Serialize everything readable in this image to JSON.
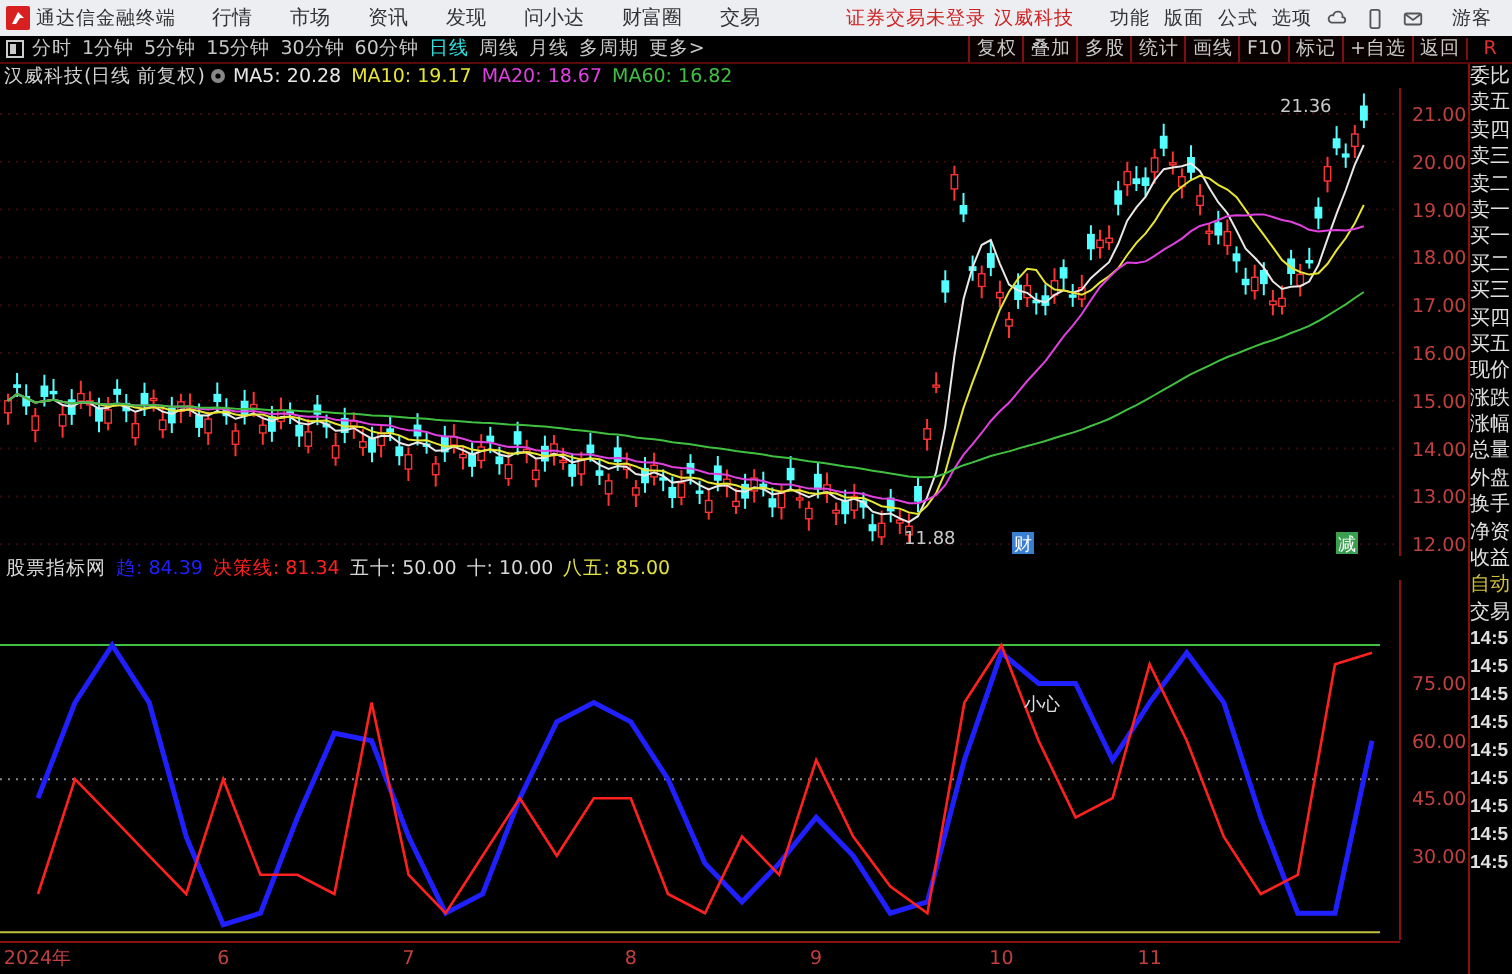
{
  "menubar": {
    "app_name": "通达信金融终端",
    "menus": [
      "行情",
      "市场",
      "资讯",
      "发现",
      "问小达",
      "财富圈",
      "交易"
    ],
    "login_notice": "证券交易未登录",
    "stock_name": "汉威科技",
    "right_menus": [
      "功能",
      "版面",
      "公式",
      "选项"
    ],
    "user": "游客"
  },
  "toolbar": {
    "periods": [
      {
        "label": "分时",
        "selected": false
      },
      {
        "label": "1分钟",
        "selected": false
      },
      {
        "label": "5分钟",
        "selected": false
      },
      {
        "label": "15分钟",
        "selected": false
      },
      {
        "label": "30分钟",
        "selected": false
      },
      {
        "label": "60分钟",
        "selected": false
      },
      {
        "label": "日线",
        "selected": true
      },
      {
        "label": "周线",
        "selected": false
      },
      {
        "label": "月线",
        "selected": false
      },
      {
        "label": "多周期",
        "selected": false
      },
      {
        "label": "更多>",
        "selected": false
      }
    ],
    "buttons": [
      "复权",
      "叠加",
      "多股",
      "统计",
      "画线",
      "F10",
      "标记",
      "+自选",
      "返回"
    ],
    "corner": "R"
  },
  "price_panel": {
    "title": "汉威科技(日线 前复权)",
    "ma_legend": [
      {
        "label": "MA5: 20.28",
        "color": "#e8e8e8"
      },
      {
        "label": "MA10: 19.17",
        "color": "#e6e633"
      },
      {
        "label": "MA20: 18.67",
        "color": "#e040e0"
      },
      {
        "label": "MA60: 16.82",
        "color": "#40c040"
      }
    ],
    "axis_labels": [
      "21.00",
      "20.00",
      "19.00",
      "18.00",
      "17.00",
      "16.00",
      "15.00",
      "14.00",
      "13.00",
      "12.00"
    ],
    "high_label": "21.36",
    "low_label": "11.88",
    "markers": [
      {
        "text": "财",
        "color": "#3a7fd0"
      },
      {
        "text": "减",
        "color": "#3aa050"
      }
    ]
  },
  "indicator_panel": {
    "title": "股票指标网",
    "legend": [
      {
        "kind": "series",
        "value": ": 84.39"
      },
      {
        "kind": "series",
        "value": ": 81.34"
      },
      {
        "kind": "level",
        "label": "五十",
        "value": ": 50.00",
        "color": "#d8d8d8"
      },
      {
        "kind": "level",
        "label": "十",
        "value": ": 10.00",
        "color": "#d8d8d8"
      },
      {
        "kind": "level",
        "label": "八五",
        "value": ": 85.00",
        "color": "#e0e040"
      }
    ],
    "note": "小心",
    "chart_data": {
      "type": "line",
      "categories": [
        "2024年",
        null,
        null,
        null,
        null,
        "6",
        null,
        null,
        null,
        null,
        "7",
        null,
        null,
        null,
        null,
        null,
        "8",
        null,
        null,
        null,
        null,
        "9",
        null,
        null,
        null,
        null,
        "10",
        null,
        null,
        null,
        "11",
        null,
        null,
        null,
        null,
        null,
        null
      ],
      "ylim": [
        8,
        102
      ],
      "yticks": [
        {
          "value": 30,
          "label": "30.00"
        },
        {
          "value": 45,
          "label": "45.00"
        },
        {
          "value": 60,
          "label": "60.00"
        },
        {
          "value": 75,
          "label": "75.00"
        }
      ],
      "series": [
        {
          "name": "趋",
          "color": "#2020ff",
          "values": [
            45,
            70,
            85,
            70,
            35,
            12,
            15,
            40,
            62,
            60,
            35,
            15,
            20,
            45,
            65,
            70,
            65,
            50,
            28,
            18,
            28,
            40,
            30,
            15,
            18,
            55,
            83,
            75,
            75,
            55,
            70,
            83,
            70,
            40,
            15,
            15,
            60
          ]
        },
        {
          "name": "决策线",
          "color": "#ff2020",
          "values": [
            20,
            50,
            40,
            30,
            20,
            50,
            25,
            25,
            20,
            70,
            25,
            15,
            30,
            45,
            30,
            45,
            45,
            20,
            15,
            35,
            25,
            55,
            35,
            22,
            15,
            70,
            85,
            60,
            40,
            45,
            80,
            60,
            35,
            20,
            25,
            80,
            83
          ]
        }
      ]
    }
  },
  "side_panel": [
    {
      "label": "委比",
      "kind": "quote"
    },
    {
      "label": "卖五",
      "kind": "quote"
    },
    {
      "label": "卖四",
      "kind": "quote"
    },
    {
      "label": "卖三",
      "kind": "quote"
    },
    {
      "label": "卖二",
      "kind": "quote"
    },
    {
      "label": "卖一",
      "kind": "quote"
    },
    {
      "label": "买一",
      "kind": "quote"
    },
    {
      "label": "买二",
      "kind": "quote"
    },
    {
      "label": "买三",
      "kind": "quote"
    },
    {
      "label": "买四",
      "kind": "quote"
    },
    {
      "label": "买五",
      "kind": "quote"
    },
    {
      "label": "现价",
      "kind": "quote"
    },
    {
      "label": "涨跌",
      "kind": "quote"
    },
    {
      "label": "涨幅",
      "kind": "quote"
    },
    {
      "label": "总量",
      "kind": "quote"
    },
    {
      "label": "外盘",
      "kind": "quote"
    },
    {
      "label": "换手",
      "kind": "quote"
    },
    {
      "label": "净资",
      "kind": "quote"
    },
    {
      "label": "收益",
      "kind": "quote"
    },
    {
      "label": "自动",
      "kind": "toggle"
    },
    {
      "label": "交易",
      "kind": "quote"
    }
  ],
  "trade_times": [
    "14:5",
    "14:5",
    "14:5",
    "14:5",
    "14:5",
    "14:5",
    "14:5",
    "14:5",
    "14:5"
  ]
}
